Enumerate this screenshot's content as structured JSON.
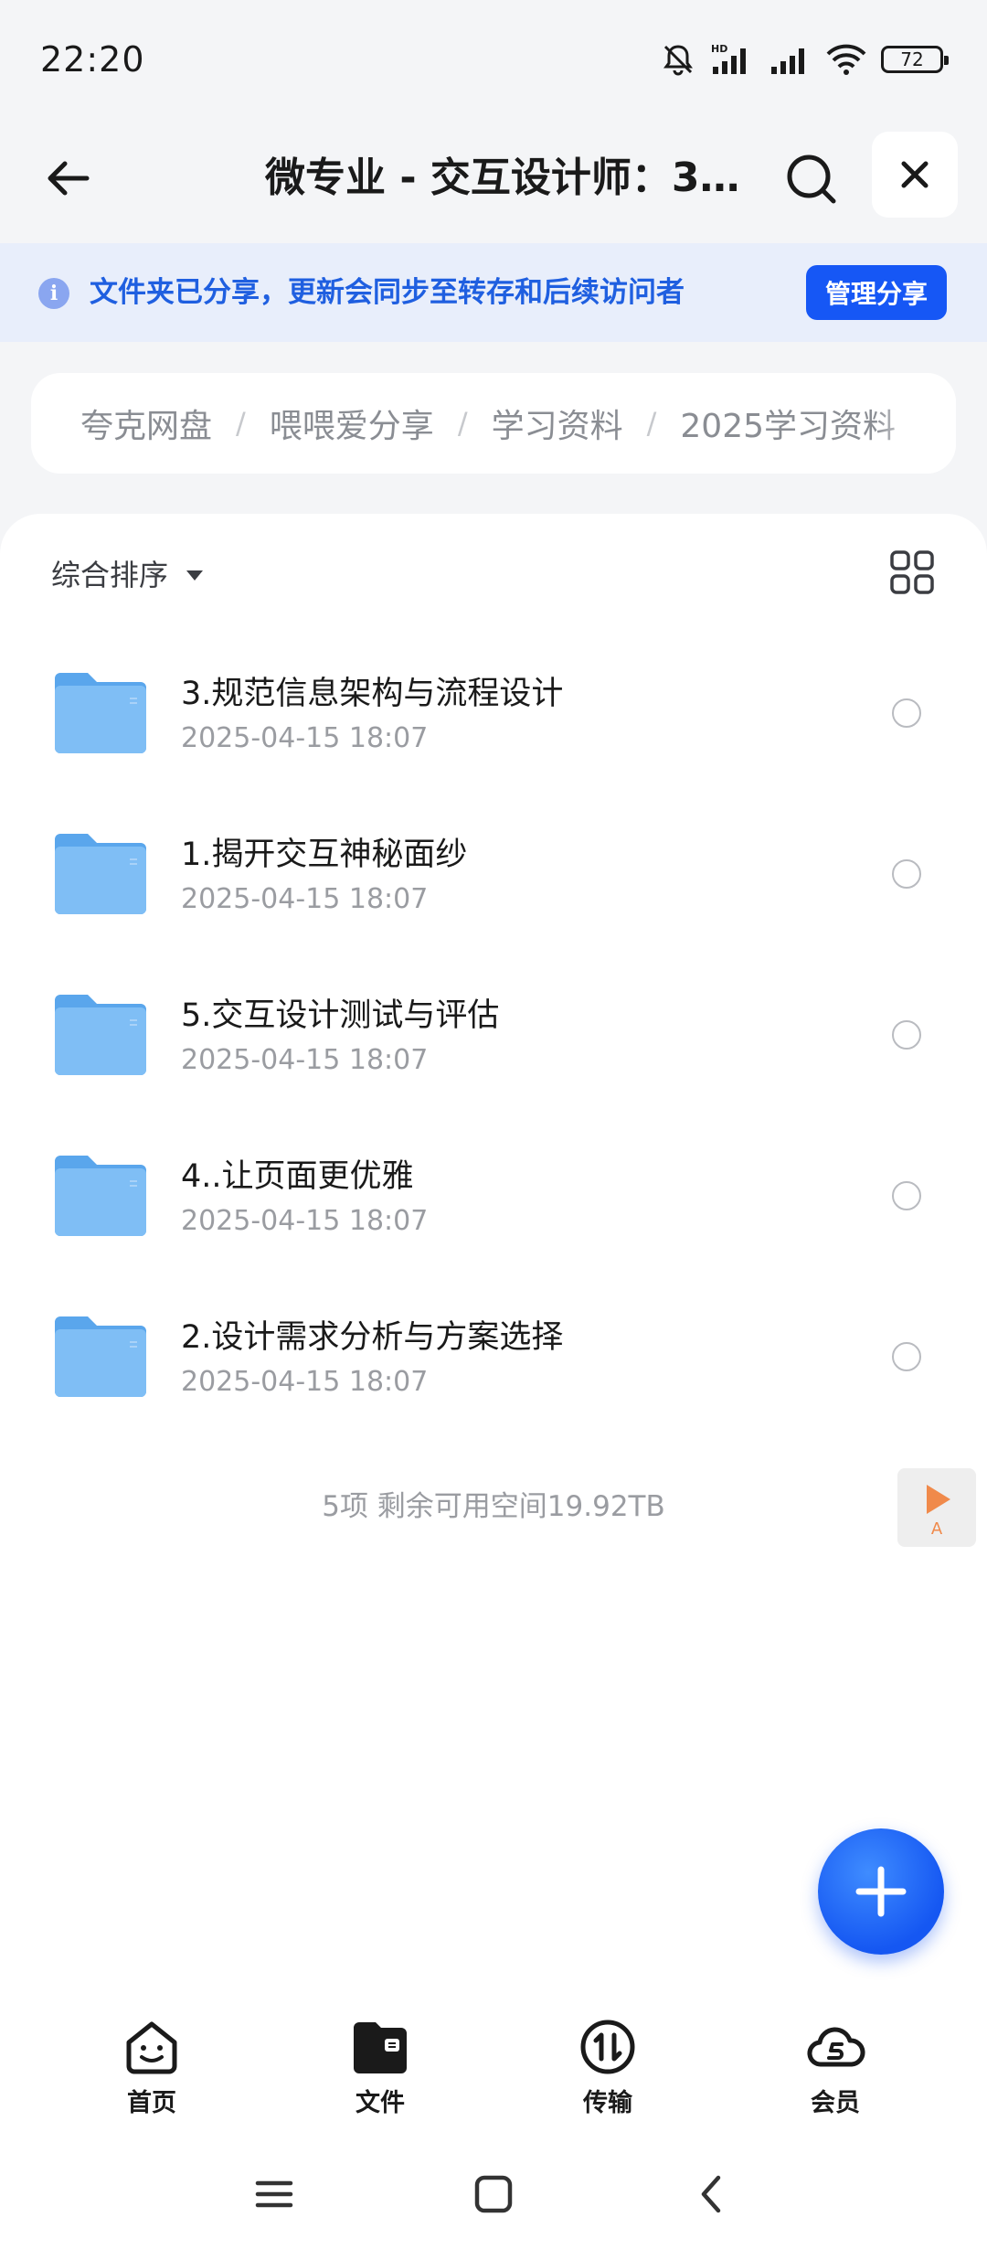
{
  "status_bar": {
    "time": "22:20",
    "battery": "72"
  },
  "header": {
    "title": "微专业 - 交互设计师：3…"
  },
  "share_banner": {
    "text": "文件夹已分享，更新会同步至转存和后续访问者",
    "manage_label": "管理分享"
  },
  "breadcrumb": {
    "items": [
      "夸克网盘",
      "喂喂爱分享",
      "学习资料",
      "2025学习资料"
    ]
  },
  "sort": {
    "label": "综合排序"
  },
  "files": [
    {
      "name": "3.规范信息架构与流程设计",
      "date": "2025-04-15 18:07"
    },
    {
      "name": "1.揭开交互神秘面纱",
      "date": "2025-04-15 18:07"
    },
    {
      "name": "5.交互设计测试与评估",
      "date": "2025-04-15 18:07"
    },
    {
      "name": "4..让页面更优雅",
      "date": "2025-04-15 18:07"
    },
    {
      "name": "2.设计需求分析与方案选择",
      "date": "2025-04-15 18:07"
    }
  ],
  "summary": "5项 剩余可用空间19.92TB",
  "float_widget_label": "A",
  "bottom_nav": [
    {
      "label": "首页",
      "icon": "home-smile-icon"
    },
    {
      "label": "文件",
      "icon": "folder-file-icon"
    },
    {
      "label": "传输",
      "icon": "transfer-icon"
    },
    {
      "label": "会员",
      "icon": "membership-cloud-icon"
    }
  ],
  "colors": {
    "accent": "#1657f5",
    "banner_bg": "#e8eefb",
    "folder": "#6fb3f2"
  }
}
